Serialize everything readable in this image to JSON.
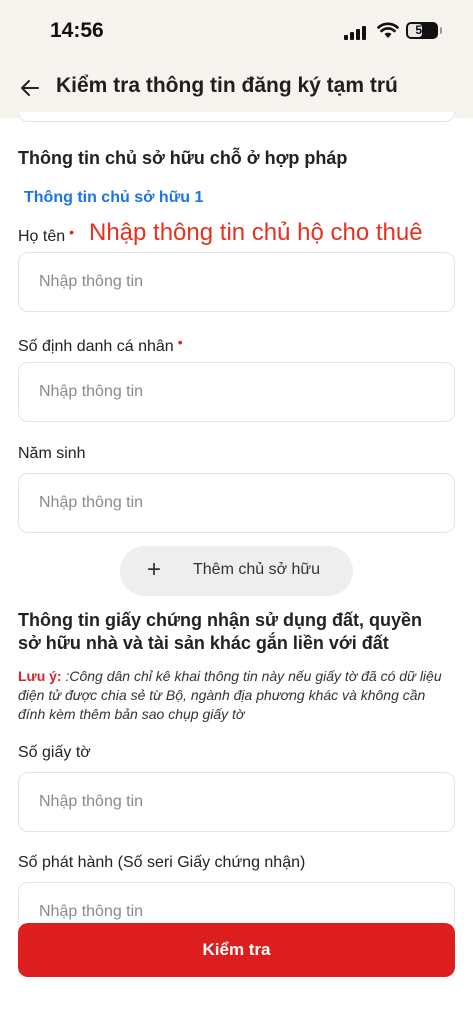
{
  "status_bar": {
    "time": "14:56",
    "battery": "50"
  },
  "header": {
    "title": "Kiểm tra thông tin đăng ký tạm trú"
  },
  "owner_section": {
    "title": "Thông tin chủ sở hữu chỗ ở hợp pháp",
    "owner_link": "Thông tin chủ sở hữu 1",
    "annotation": "Nhập thông tin chủ hộ cho thuê",
    "fields": [
      {
        "label": "Họ tên",
        "required_mark": "•",
        "placeholder": "Nhập thông tin"
      },
      {
        "label": "Số định danh cá nhân",
        "required_mark": "•",
        "placeholder": "Nhập thông tin"
      },
      {
        "label": "Năm sinh",
        "placeholder": "Nhập thông tin"
      }
    ],
    "add_owner": {
      "icon": "+",
      "label": "Thêm chủ sở hữu"
    }
  },
  "certificate_section": {
    "title_line1": "Thông tin giấy chứng nhận sử dụng đất, quyền",
    "title_line2": "sở hữu nhà và tài sản khác gắn liền với đất",
    "note_label": "Lưu ý:",
    "note_text": " :Công dân chỉ kê khai thông tin này nếu giấy tờ đã có dữ liệu điện tử được chia sẻ từ Bộ, ngành địa phương khác và không cần đính kèm thêm bản sao chụp giấy tờ",
    "fields": [
      {
        "label": "Số giấy tờ",
        "placeholder": "Nhập thông tin"
      },
      {
        "label": "Số phát hành (Số seri Giấy chứng nhận)",
        "placeholder": "Nhập thông tin"
      }
    ]
  },
  "footer": {
    "check_button": "Kiểm tra"
  },
  "colors": {
    "accent": "#dd1e1e",
    "link": "#1a73e8",
    "required": "#d6232a",
    "annotation": "#e8301f"
  },
  "icons": {
    "back": "arrow-left-icon",
    "signal": "cellular-signal-icon",
    "wifi": "wifi-icon",
    "battery": "battery-icon",
    "add": "plus-icon"
  }
}
